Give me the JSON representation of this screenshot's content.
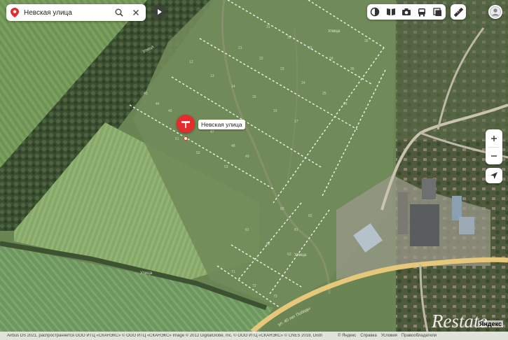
{
  "search": {
    "query": "Невская улица"
  },
  "marker": {
    "label": "Невская улица"
  },
  "map_labels": {
    "street1": "Улица",
    "street2": "Улица",
    "street3": "Улица",
    "street4": "Улица",
    "road": "ул. 40 лет Победы"
  },
  "attribution": {
    "copyright": "Airbus DS 2021, распространяется ООО ИТЦ «СКАНЭКС» © ООО ИТЦ «СКАНЭКС» Image © 2012 DigitalGlobe, Inc. © ООО ИТЦ «СКАНЭКС» © CNES 2018, Distribution Airbus DS",
    "yandex_copy": "© Яндекс",
    "help": "Справка",
    "terms": "Условия",
    "owners": "Правообладатели"
  },
  "logo": {
    "text": "Яндекс"
  },
  "watermark": {
    "text": "Restate"
  },
  "colors": {
    "marker": "#e52b2b",
    "road": "#e6c87a"
  }
}
